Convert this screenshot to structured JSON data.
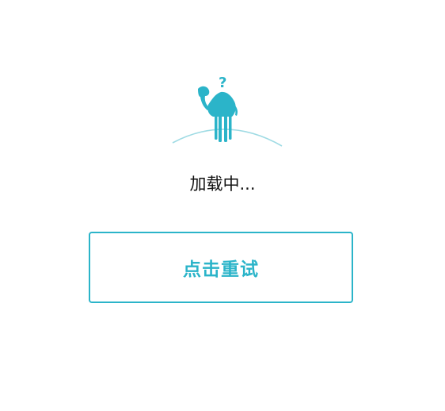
{
  "status": {
    "loading_text": "加载中..."
  },
  "actions": {
    "retry_label": "点击重试"
  },
  "illustration": {
    "question_mark": "?",
    "icon": "camel-icon"
  },
  "colors": {
    "accent": "#2bb4c9",
    "horizon": "#9fdbe4",
    "text": "#111111",
    "background": "#ffffff"
  }
}
